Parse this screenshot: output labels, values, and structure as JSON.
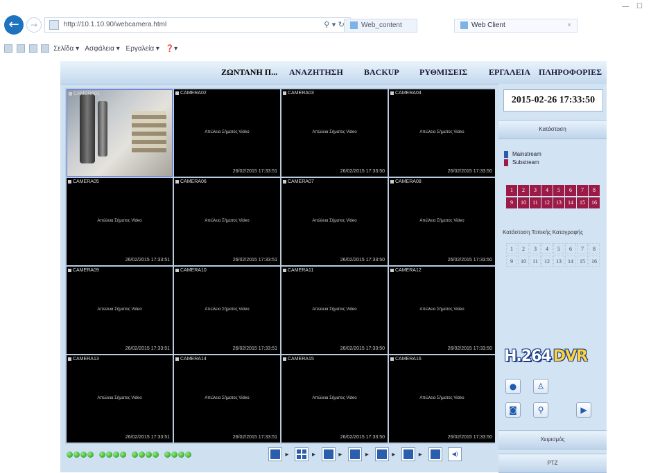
{
  "browser": {
    "address_url": "http://10.1.10.90/webcamera.html",
    "address_controls": "⚲ ▾ ↻",
    "tab1_label": "Web_content",
    "tab2_label": "Web Client",
    "tab_close": "×",
    "window_controls": "— ☐",
    "back_icon": "←",
    "forward_icon": "→",
    "commands": [
      "Σελίδα ▾",
      "Ασφάλεια ▾",
      "Εργαλεία ▾",
      "❓▾"
    ]
  },
  "nav": {
    "items": [
      "ΖΩΝΤΑΝΗ Π...",
      "ΑΝΑΖΗΤΗΣΗ",
      "BACKUP",
      "ΡΥΘΜΙΣΕΙΣ",
      "ΕΡΓΑΛΕΙΑ",
      "ΠΛΗΡΟΦΟΡΙΕΣ"
    ]
  },
  "grid": {
    "cells": [
      {
        "label": "CAMERA01",
        "video": "",
        "time": ""
      },
      {
        "label": "CAMERA02",
        "video": "Απώλεια Σήματος Video",
        "time": "26/02/2015 17:33:51"
      },
      {
        "label": "CAMERA03",
        "video": "Απώλεια Σήματος Video",
        "time": "26/02/2015 17:33:50"
      },
      {
        "label": "CAMERA04",
        "video": "Απώλεια Σήματος Video",
        "time": "26/02/2015 17:33:50"
      },
      {
        "label": "CAMERA05",
        "video": "Απώλεια Σήματος Video",
        "time": "26/02/2015 17:33:51"
      },
      {
        "label": "CAMERA06",
        "video": "Απώλεια Σήματος Video",
        "time": "26/02/2015 17:33:51"
      },
      {
        "label": "CAMERA07",
        "video": "Απώλεια Σήματος Video",
        "time": "26/02/2015 17:33:50"
      },
      {
        "label": "CAMERA08",
        "video": "Απώλεια Σήματος Video",
        "time": "26/02/2015 17:33:50"
      },
      {
        "label": "CAMERA09",
        "video": "Απώλεια Σήματος Video",
        "time": "26/02/2015 17:33:51"
      },
      {
        "label": "CAMERA10",
        "video": "Απώλεια Σήματος Video",
        "time": "26/02/2015 17:33:51"
      },
      {
        "label": "CAMERA11",
        "video": "Απώλεια Σήματος Video",
        "time": "26/02/2015 17:33:50"
      },
      {
        "label": "CAMERA12",
        "video": "Απώλεια Σήματος Video",
        "time": "26/02/2015 17:33:50"
      },
      {
        "label": "CAMERA13",
        "video": "Απώλεια Σήματος Video",
        "time": "26/02/2015 17:33:51"
      },
      {
        "label": "CAMERA14",
        "video": "Απώλεια Σήματος Video",
        "time": "26/02/2015 17:33:51"
      },
      {
        "label": "CAMERA15",
        "video": "Απώλεια Σήματος Video",
        "time": "26/02/2015 17:33:50"
      },
      {
        "label": "CAMERA16",
        "video": "Απώλεια Σήματος Video",
        "time": "26/02/2015 17:33:50"
      }
    ]
  },
  "right_panel": {
    "datetime": "2015-02-26 17:33:50",
    "status_button": "Κατάσταση",
    "legend": [
      "Mainstream",
      "Substream"
    ],
    "channels": [
      "1",
      "2",
      "3",
      "4",
      "5",
      "6",
      "7",
      "8",
      "9",
      "10",
      "11",
      "12",
      "13",
      "14",
      "15",
      "16"
    ],
    "record_title": "Κατάσταση Τοπικής Καταγραφής",
    "record_channels": [
      "1",
      "2",
      "3",
      "4",
      "5",
      "6",
      "7",
      "8",
      "9",
      "10",
      "11",
      "12",
      "13",
      "14",
      "15",
      "16"
    ],
    "logo_h264": "H.264",
    "logo_dvr": "DVR",
    "tools": [
      {
        "name": "rec-icon",
        "glyph": "●"
      },
      {
        "name": "stop-rec-icon",
        "glyph": "♙"
      },
      {
        "name": "snapshot-icon",
        "glyph": "◙"
      },
      {
        "name": "search-icon",
        "glyph": "⚲"
      },
      {
        "name": "play-icon",
        "glyph": "▶"
      }
    ],
    "bottom_button_1": "Χειρισμός",
    "bottom_button_2": "PTZ"
  },
  "bottom": {
    "layout_sep": "▸",
    "audio_icon": "◀)"
  },
  "colors": {
    "accent": "#1e73be",
    "channel_on": "#9b1a46",
    "mainstream": "#2c5aa8",
    "substream": "#9b1a46",
    "status_ok": "#2fa82f"
  }
}
